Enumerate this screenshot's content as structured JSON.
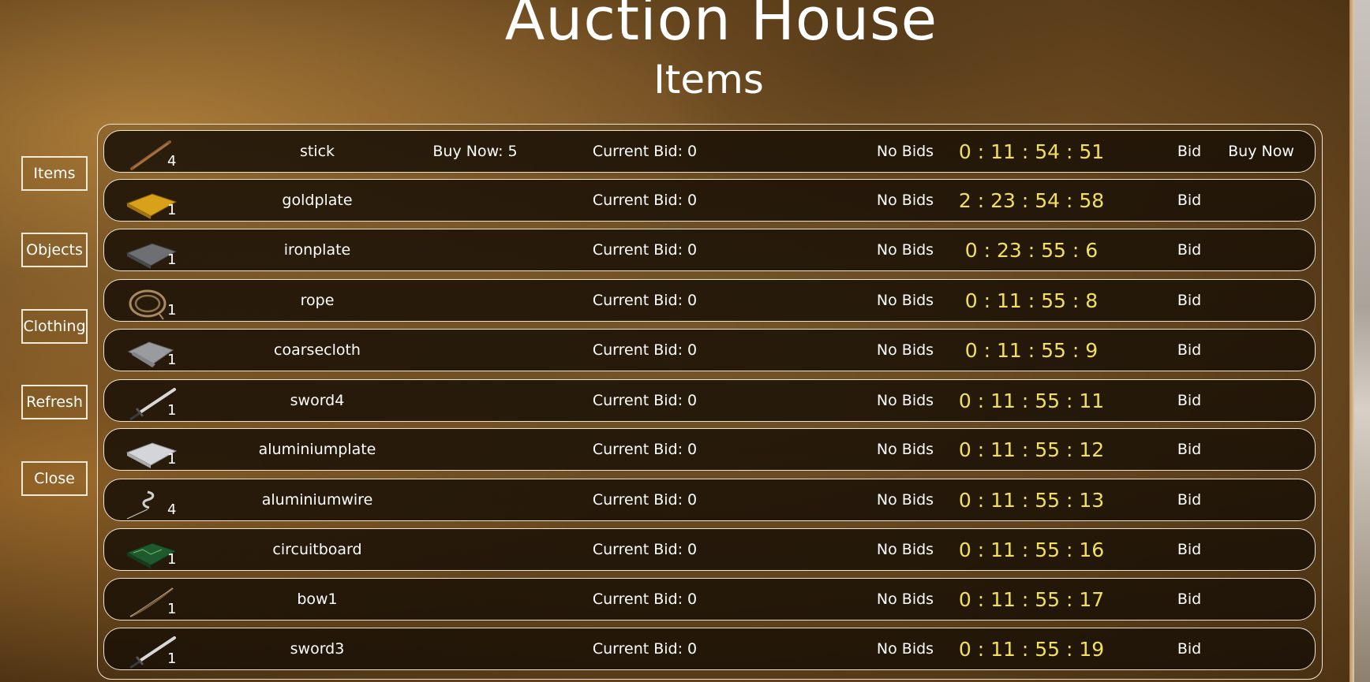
{
  "header": {
    "title": "Auction House",
    "subtitle": "Items"
  },
  "sidebar": {
    "items": [
      {
        "label": "Items"
      },
      {
        "label": "Objects"
      },
      {
        "label": "Clothing"
      },
      {
        "label": "Refresh"
      },
      {
        "label": "Close"
      }
    ]
  },
  "listings": [
    {
      "icon": "stick-icon",
      "qty": "4",
      "name": "stick",
      "buy_now_price": "Buy Now: 5",
      "current_bid": "Current Bid: 0",
      "bids": "No Bids",
      "timer": "0 : 11 : 54 : 51",
      "bid_label": "Bid",
      "buy_now_label": "Buy Now"
    },
    {
      "icon": "goldplate-icon",
      "qty": "1",
      "name": "goldplate",
      "current_bid": "Current Bid: 0",
      "bids": "No Bids",
      "timer": "2 : 23 : 54 : 58",
      "bid_label": "Bid"
    },
    {
      "icon": "ironplate-icon",
      "qty": "1",
      "name": "ironplate",
      "current_bid": "Current Bid: 0",
      "bids": "No Bids",
      "timer": "0 : 23 : 55 : 6",
      "bid_label": "Bid"
    },
    {
      "icon": "rope-icon",
      "qty": "1",
      "name": "rope",
      "current_bid": "Current Bid: 0",
      "bids": "No Bids",
      "timer": "0 : 11 : 55 : 8",
      "bid_label": "Bid"
    },
    {
      "icon": "coarsecloth-icon",
      "qty": "1",
      "name": "coarsecloth",
      "current_bid": "Current Bid: 0",
      "bids": "No Bids",
      "timer": "0 : 11 : 55 : 9",
      "bid_label": "Bid"
    },
    {
      "icon": "sword-icon",
      "qty": "1",
      "name": "sword4",
      "current_bid": "Current Bid: 0",
      "bids": "No Bids",
      "timer": "0 : 11 : 55 : 11",
      "bid_label": "Bid"
    },
    {
      "icon": "aluminiumplate-icon",
      "qty": "1",
      "name": "aluminiumplate",
      "current_bid": "Current Bid: 0",
      "bids": "No Bids",
      "timer": "0 : 11 : 55 : 12",
      "bid_label": "Bid"
    },
    {
      "icon": "aluminiumwire-icon",
      "qty": "4",
      "name": "aluminiumwire",
      "current_bid": "Current Bid: 0",
      "bids": "No Bids",
      "timer": "0 : 11 : 55 : 13",
      "bid_label": "Bid"
    },
    {
      "icon": "circuitboard-icon",
      "qty": "1",
      "name": "circuitboard",
      "current_bid": "Current Bid: 0",
      "bids": "No Bids",
      "timer": "0 : 11 : 55 : 16",
      "bid_label": "Bid"
    },
    {
      "icon": "bow-icon",
      "qty": "1",
      "name": "bow1",
      "current_bid": "Current Bid: 0",
      "bids": "No Bids",
      "timer": "0 : 11 : 55 : 17",
      "bid_label": "Bid"
    },
    {
      "icon": "sword-icon",
      "qty": "1",
      "name": "sword3",
      "current_bid": "Current Bid: 0",
      "bids": "No Bids",
      "timer": "0 : 11 : 55 : 19",
      "bid_label": "Bid"
    }
  ],
  "colors": {
    "timer": "#f3e05a",
    "text": "#ffffff",
    "border": "#eee3cf"
  }
}
